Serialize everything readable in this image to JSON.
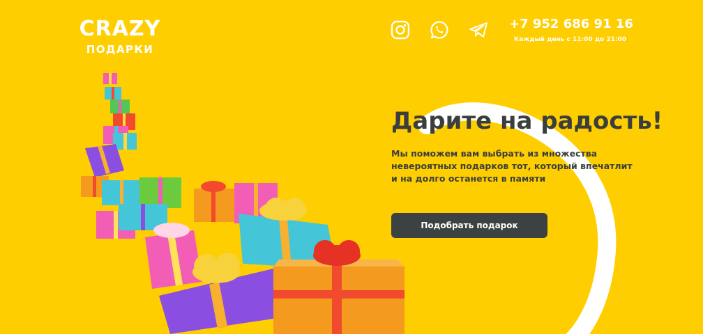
{
  "header": {
    "logo": {
      "main": "CRAZY",
      "sub": "ПОДАРКИ"
    },
    "social_icons": [
      "instagram-icon",
      "whatsapp-icon",
      "telegram-icon"
    ],
    "phone": "+7 952 686 91 16",
    "hours": "Каждый день с 11:00 до 21:00"
  },
  "hero": {
    "title": "Дарите на радость!",
    "text": "Мы поможем вам выбрать из множества невероятных подарков тот, который впечатлит и на долго останется в памяти",
    "cta_label": "Подобрать подарок"
  },
  "colors": {
    "background": "#FFCE00",
    "text_dark": "#3A3F3D",
    "button": "#3C4242",
    "white": "#FFFFFF"
  }
}
